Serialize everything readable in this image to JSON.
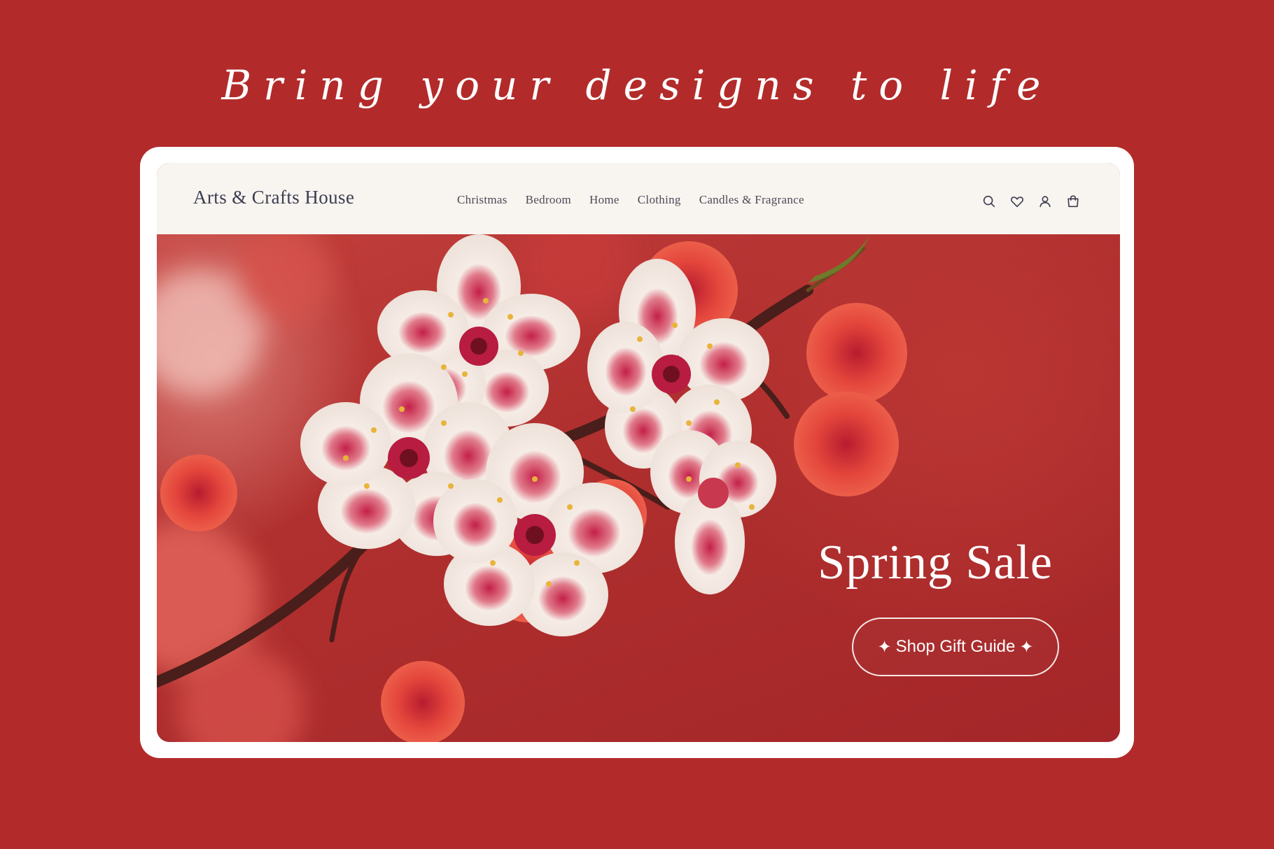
{
  "tagline": "Bring your designs to life",
  "header": {
    "brand": "Arts & Crafts House",
    "nav": [
      {
        "label": "Christmas"
      },
      {
        "label": "Bedroom"
      },
      {
        "label": "Home"
      },
      {
        "label": "Clothing"
      },
      {
        "label": "Candles & Fragrance"
      }
    ],
    "icons": [
      "search-icon",
      "heart-icon",
      "account-icon",
      "shopping-bag-icon"
    ]
  },
  "hero": {
    "headline": "Spring Sale",
    "cta": {
      "label": "Shop Gift Guide",
      "icon": "sparkle-icon",
      "glyph": "✦"
    }
  },
  "colors": {
    "page_background": "#b22b2a",
    "header_background": "#f8f4ef",
    "brand_text": "#3c3d52",
    "hero_background": "#b0292b",
    "blossom_white": "#f6efe9",
    "blossom_coral": "#e8483f"
  }
}
